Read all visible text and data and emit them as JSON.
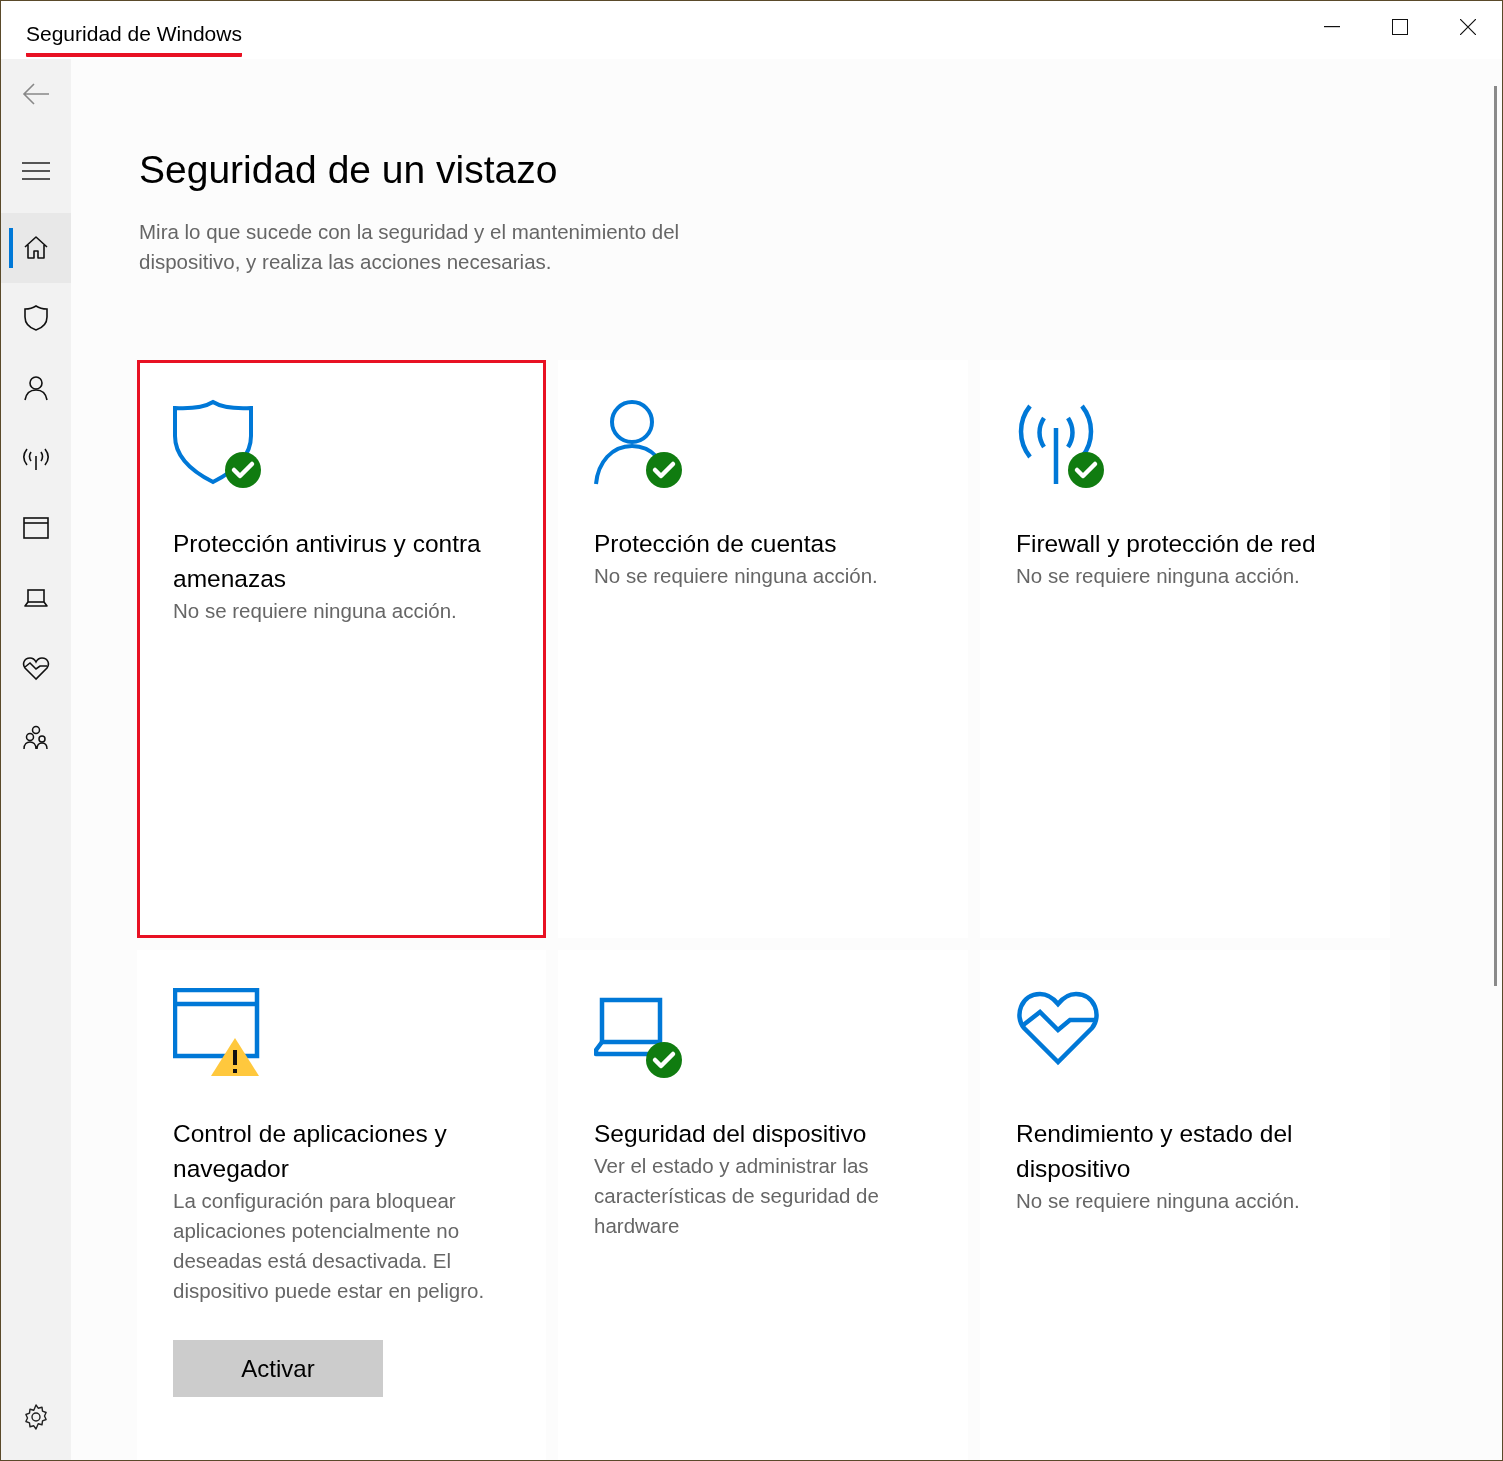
{
  "window": {
    "title": "Seguridad de Windows",
    "title_underlined": true
  },
  "sidebar": {
    "items": [
      {
        "kind": "home",
        "selected": true
      },
      {
        "kind": "shield",
        "selected": false
      },
      {
        "kind": "person",
        "selected": false
      },
      {
        "kind": "antenna",
        "selected": false
      },
      {
        "kind": "browser",
        "selected": false
      },
      {
        "kind": "laptop",
        "selected": false
      },
      {
        "kind": "heart",
        "selected": false
      },
      {
        "kind": "family",
        "selected": false
      }
    ]
  },
  "page": {
    "heading": "Seguridad de un vistazo",
    "description": "Mira lo que sucede con la seguridad y el mantenimiento del dispositivo, y realiza las acciones necesarias."
  },
  "cards": [
    {
      "kind": "shield",
      "ok": true,
      "warning": false,
      "title": "Protección antivirus y contra amenazas",
      "description": "No se requiere ninguna acción.",
      "highlighted": true
    },
    {
      "kind": "person",
      "ok": true,
      "warning": false,
      "title": "Protección de cuentas",
      "description": "No se requiere ninguna acción.",
      "highlighted": false
    },
    {
      "kind": "antenna",
      "ok": true,
      "warning": false,
      "title": "Firewall y protección de red",
      "description": "No se requiere ninguna acción.",
      "highlighted": false
    },
    {
      "kind": "browser",
      "ok": false,
      "warning": true,
      "title": "Control de aplicaciones y navegador",
      "description": "La configuración para bloquear aplicaciones potencialmente no deseadas está desactivada. El dispositivo puede estar en peligro.",
      "highlighted": false,
      "button": "Activar"
    },
    {
      "kind": "laptop",
      "ok": true,
      "warning": false,
      "title": "Seguridad del dispositivo",
      "description": "Ver el estado y administrar las características de seguridad de hardware",
      "highlighted": false
    },
    {
      "kind": "heart",
      "ok": false,
      "warning": false,
      "title": "Rendimiento y estado del dispositivo",
      "description": "No se requiere ninguna acción.",
      "highlighted": false
    }
  ]
}
